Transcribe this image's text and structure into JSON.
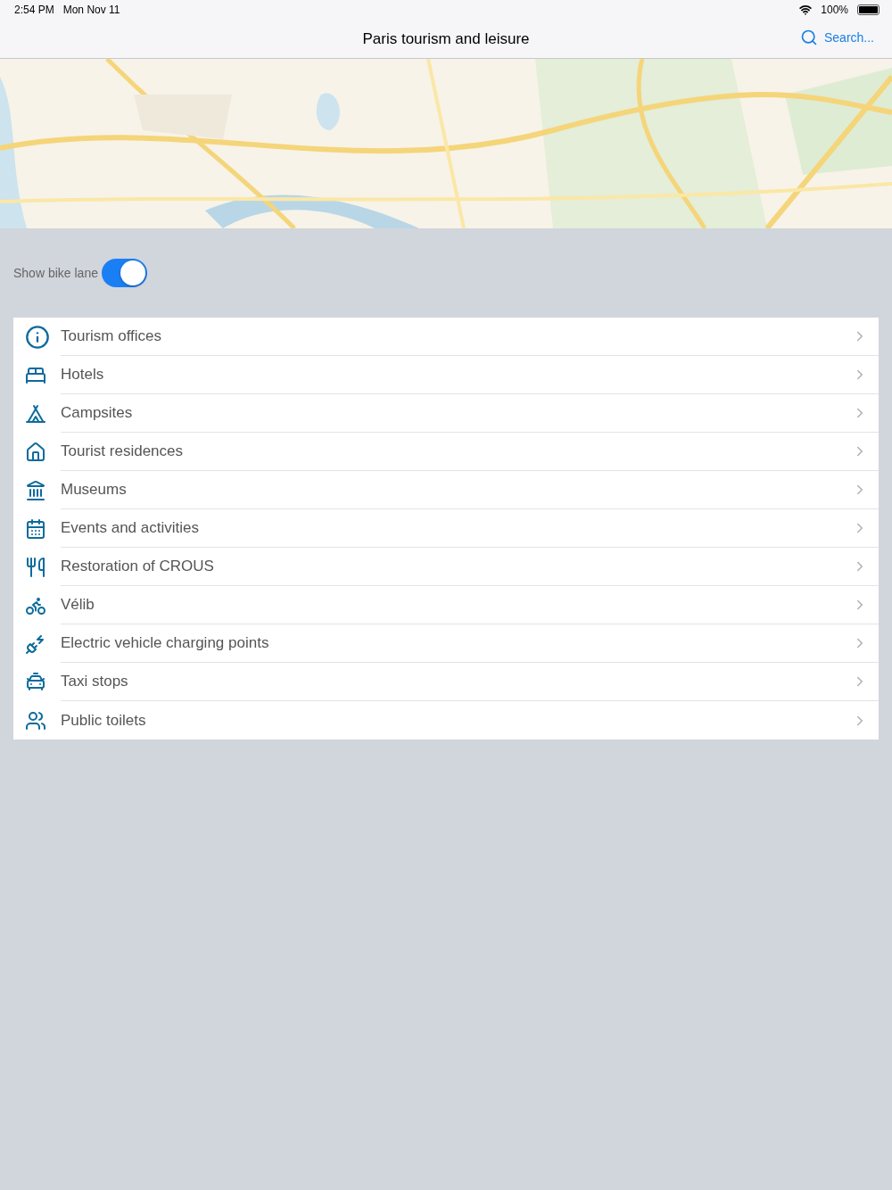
{
  "status_bar": {
    "time": "2:54 PM",
    "date": "Mon Nov 11",
    "battery": "100%"
  },
  "nav_bar": {
    "title": "Paris tourism and leisure",
    "search": "Search..."
  },
  "bike_lane": {
    "label": "Show bike lane",
    "on": true
  },
  "categories": [
    {
      "label": "Tourism offices",
      "kind": "info"
    },
    {
      "label": "Hotels",
      "kind": "bed"
    },
    {
      "label": "Campsites",
      "kind": "tent"
    },
    {
      "label": "Tourist residences",
      "kind": "house"
    },
    {
      "label": "Museums",
      "kind": "museum"
    },
    {
      "label": "Events and activities",
      "kind": "calendar"
    },
    {
      "label": "Restoration of CROUS",
      "kind": "restaurant"
    },
    {
      "label": "Vélib",
      "kind": "bike"
    },
    {
      "label": "Electric vehicle charging points",
      "kind": "charger"
    },
    {
      "label": "Taxi stops",
      "kind": "taxi"
    },
    {
      "label": "Public toilets",
      "kind": "toilets"
    }
  ]
}
